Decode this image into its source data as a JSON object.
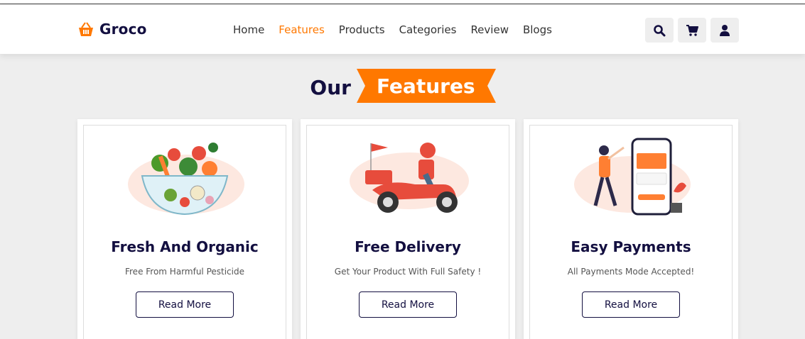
{
  "brand": {
    "name": "Groco"
  },
  "nav": [
    {
      "label": "Home",
      "active": false
    },
    {
      "label": "Features",
      "active": true
    },
    {
      "label": "Products",
      "active": false
    },
    {
      "label": "Categories",
      "active": false
    },
    {
      "label": "Review",
      "active": false
    },
    {
      "label": "Blogs",
      "active": false
    }
  ],
  "header_icons": [
    "search-icon",
    "cart-icon",
    "user-icon"
  ],
  "section": {
    "title_plain": "Our",
    "title_highlight": "Features"
  },
  "cards": [
    {
      "title": "Fresh And Organic",
      "text": "Free From Harmful Pesticide",
      "button": "Read More",
      "image": "vegetable-bowl-illustration"
    },
    {
      "title": "Free Delivery",
      "text": "Get Your Product With Full Safety !",
      "button": "Read More",
      "image": "delivery-scooter-illustration"
    },
    {
      "title": "Easy Payments",
      "text": "All Payments Mode Accepted!",
      "button": "Read More",
      "image": "phone-payment-illustration"
    }
  ],
  "colors": {
    "accent": "#ff7800",
    "dark": "#130f40",
    "background": "#eeeeee"
  }
}
